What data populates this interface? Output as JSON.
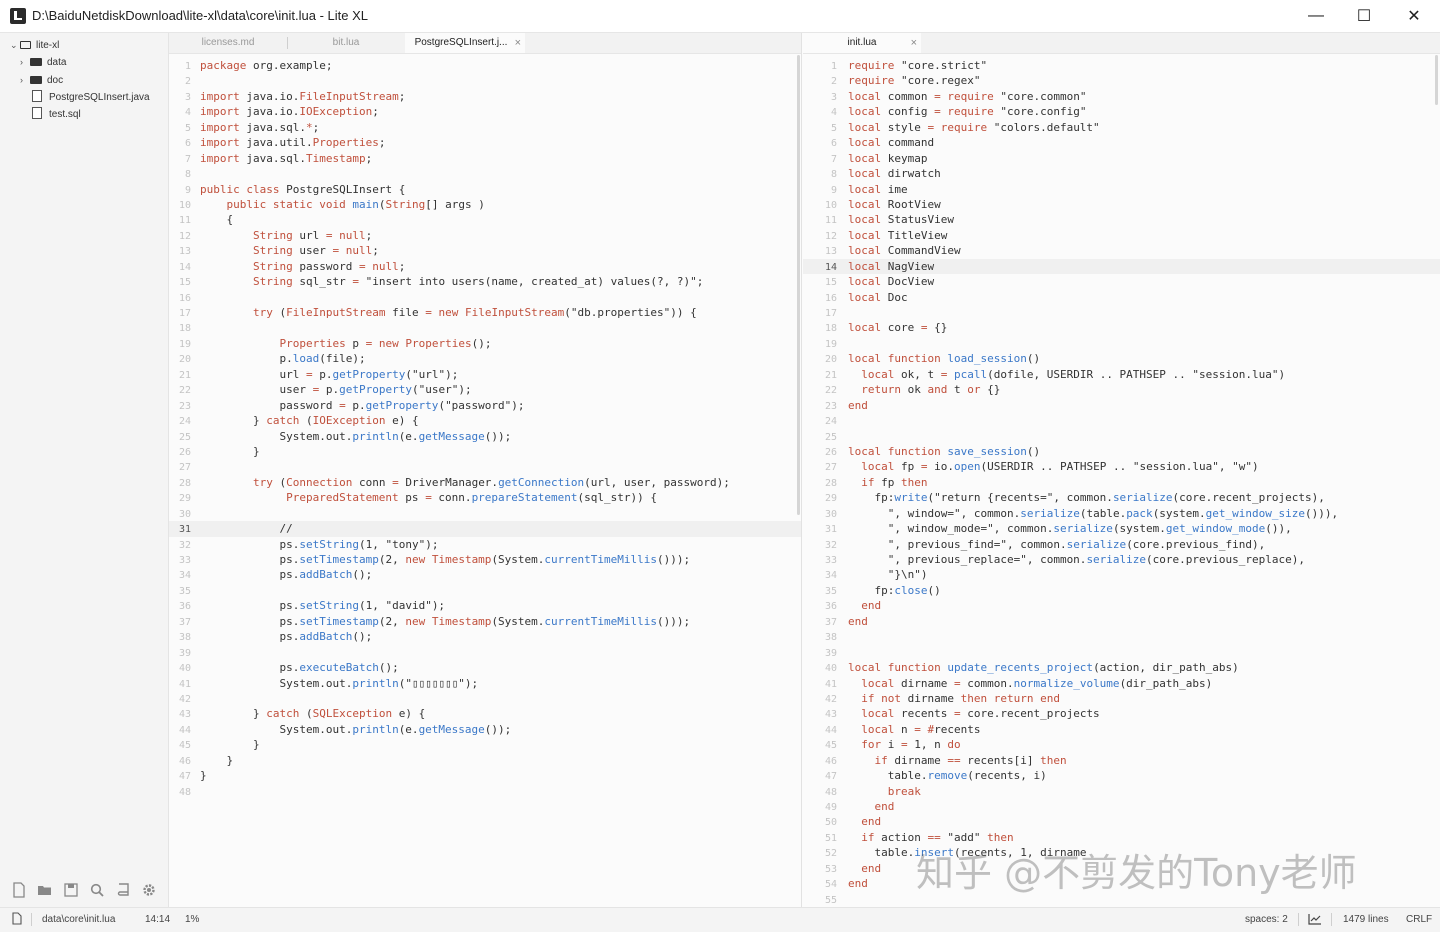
{
  "window": {
    "title": "D:\\BaiduNetdiskDownload\\lite-xl\\data\\core\\init.lua - Lite XL",
    "minimize": "—",
    "maximize": "☐",
    "close": "✕"
  },
  "sidebar": {
    "root": "lite-xl",
    "items": [
      {
        "label": "data",
        "type": "folder"
      },
      {
        "label": "doc",
        "type": "folder"
      },
      {
        "label": "PostgreSQLInsert.java",
        "type": "file"
      },
      {
        "label": "test.sql",
        "type": "file"
      }
    ],
    "tools": [
      "new-file-icon",
      "open-folder-icon",
      "save-icon",
      "search-icon",
      "book-icon",
      "gear-icon"
    ]
  },
  "left_pane": {
    "tabs": [
      {
        "label": "licenses.md"
      },
      {
        "label": "bit.lua"
      },
      {
        "label": "PostgreSQLInsert.j...",
        "close": "×"
      }
    ],
    "lines": [
      "package org.example;",
      "",
      "import java.io.FileInputStream;",
      "import java.io.IOException;",
      "import java.sql.*;",
      "import java.util.Properties;",
      "import java.sql.Timestamp;",
      "",
      "public class PostgreSQLInsert {",
      "    public static void main(String[] args )",
      "    {",
      "        String url = null;",
      "        String user = null;",
      "        String password = null;",
      "        String sql_str = \"insert into users(name, created_at) values(?, ?)\";",
      "",
      "        try (FileInputStream file = new FileInputStream(\"db.properties\")) {",
      "",
      "            Properties p = new Properties();",
      "            p.load(file);",
      "            url = p.getProperty(\"url\");",
      "            user = p.getProperty(\"user\");",
      "            password = p.getProperty(\"password\");",
      "        } catch (IOException e) {",
      "            System.out.println(e.getMessage());",
      "        }",
      "",
      "        try (Connection conn = DriverManager.getConnection(url, user, password);",
      "             PreparedStatement ps = conn.prepareStatement(sql_str)) {",
      "",
      "            //",
      "            ps.setString(1, \"tony\");",
      "            ps.setTimestamp(2, new Timestamp(System.currentTimeMillis()));",
      "            ps.addBatch();",
      "",
      "            ps.setString(1, \"david\");",
      "            ps.setTimestamp(2, new Timestamp(System.currentTimeMillis()));",
      "            ps.addBatch();",
      "",
      "            ps.executeBatch();",
      "            System.out.println(\"▯▯▯▯▯▯▯\");",
      "",
      "        } catch (SQLException e) {",
      "            System.out.println(e.getMessage());",
      "        }",
      "    }",
      "}",
      ""
    ],
    "current_line": 31
  },
  "right_pane": {
    "tabs": [
      {
        "label": "init.lua",
        "close": "×"
      }
    ],
    "lines": [
      "require \"core.strict\"",
      "require \"core.regex\"",
      "local common = require \"core.common\"",
      "local config = require \"core.config\"",
      "local style = require \"colors.default\"",
      "local command",
      "local keymap",
      "local dirwatch",
      "local ime",
      "local RootView",
      "local StatusView",
      "local TitleView",
      "local CommandView",
      "local NagView",
      "local DocView",
      "local Doc",
      "",
      "local core = {}",
      "",
      "local function load_session()",
      "  local ok, t = pcall(dofile, USERDIR .. PATHSEP .. \"session.lua\")",
      "  return ok and t or {}",
      "end",
      "",
      "",
      "local function save_session()",
      "  local fp = io.open(USERDIR .. PATHSEP .. \"session.lua\", \"w\")",
      "  if fp then",
      "    fp:write(\"return {recents=\", common.serialize(core.recent_projects),",
      "      \", window=\", common.serialize(table.pack(system.get_window_size())),",
      "      \", window_mode=\", common.serialize(system.get_window_mode()),",
      "      \", previous_find=\", common.serialize(core.previous_find),",
      "      \", previous_replace=\", common.serialize(core.previous_replace),",
      "      \"}\\n\")",
      "    fp:close()",
      "  end",
      "end",
      "",
      "",
      "local function update_recents_project(action, dir_path_abs)",
      "  local dirname = common.normalize_volume(dir_path_abs)",
      "  if not dirname then return end",
      "  local recents = core.recent_projects",
      "  local n = #recents",
      "  for i = 1, n do",
      "    if dirname == recents[i] then",
      "      table.remove(recents, i)",
      "      break",
      "    end",
      "  end",
      "  if action == \"add\" then",
      "    table.insert(recents, 1, dirname",
      "  end",
      "end",
      ""
    ],
    "current_line": 14
  },
  "statusbar": {
    "path": "data\\core\\init.lua",
    "position": "14:14",
    "percent": "1%",
    "indent": "spaces: 2",
    "lines": "1479 lines",
    "eol": "CRLF"
  },
  "watermark": "知乎 @不剪发的Tony老师",
  "colors": {
    "keyword": "#c0503c",
    "string": "#333333",
    "function": "#3b78c8",
    "text": "#333333",
    "line_number": "#c4c4c4"
  }
}
